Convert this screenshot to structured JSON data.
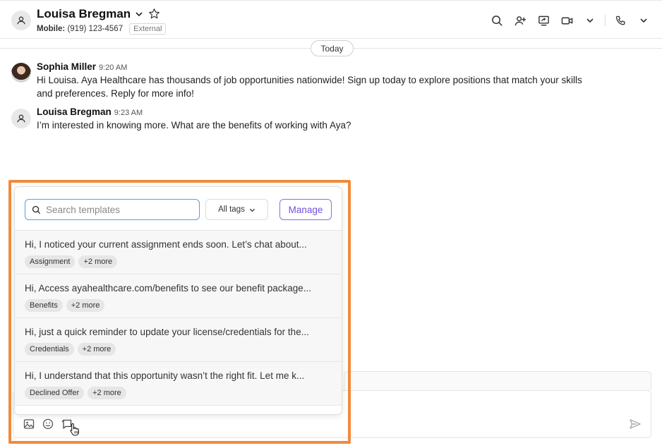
{
  "header": {
    "contact_name": "Louisa Bregman",
    "mobile_label": "Mobile:",
    "mobile_number": "(919) 123-4567",
    "external_badge": "External"
  },
  "divider": {
    "today_label": "Today"
  },
  "messages": [
    {
      "author": "Sophia Miller",
      "time": "9:20 AM",
      "text_line1": "Hi Louisa. Aya Healthcare has thousands of job opportunities nationwide! Sign up today to explore positions that match your skills",
      "text_line2": "and preferences. Reply for more info!"
    },
    {
      "author": "Louisa Bregman",
      "time": "9:23 AM",
      "text_line1": "I’m interested in knowing more. What are the benefits of working with Aya?"
    }
  ],
  "templates_popup": {
    "search_placeholder": "Search templates",
    "tags_filter_label": "All tags",
    "manage_label": "Manage",
    "items": [
      {
        "text": "Hi, I noticed your current assignment ends soon. Let’s chat about...",
        "tag": "Assignment",
        "more": "+2 more"
      },
      {
        "text": "Hi, Access ayahealthcare.com/benefits to see our benefit package...",
        "tag": "Benefits",
        "more": "+2 more"
      },
      {
        "text": "Hi, just a quick reminder to update your license/credentials for the...",
        "tag": "Credentials",
        "more": "+2 more"
      },
      {
        "text": "Hi, I understand that this opportunity wasn’t the right fit. Let me k...",
        "tag": "Declined Offer",
        "more": "+2 more"
      }
    ]
  },
  "colors": {
    "highlight": "#f28a3a",
    "manage_accent": "#7350e0",
    "search_focus": "#5a9fd8"
  },
  "icons": {
    "header_actions": [
      "search-icon",
      "add-person-icon",
      "share-screen-icon",
      "video-icon",
      "chevron-down-icon",
      "phone-icon",
      "chevron-down-icon"
    ],
    "composer": [
      "image-icon",
      "emoji-icon",
      "template-icon",
      "send-icon"
    ]
  }
}
